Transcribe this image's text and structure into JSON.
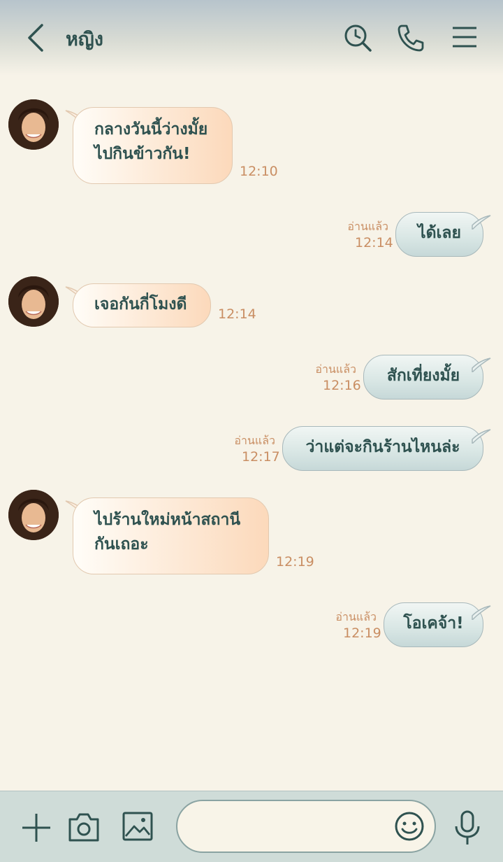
{
  "header": {
    "title": "หญิง",
    "icons": [
      "back-icon",
      "search-history-icon",
      "phone-icon",
      "menu-icon"
    ]
  },
  "messages": [
    {
      "side": "left",
      "text": "กลางวันนี้ว่างมั้ย\nไปกินข้าวกัน!",
      "time": "12:10"
    },
    {
      "side": "right",
      "text": "ได้เลย",
      "time": "12:14",
      "read": "อ่านแล้ว"
    },
    {
      "side": "left",
      "text": "เจอกันกี่โมงดี",
      "time": "12:14"
    },
    {
      "side": "right",
      "text": "สักเที่ยงมั้ย",
      "time": "12:16",
      "read": "อ่านแล้ว"
    },
    {
      "side": "right",
      "text": "ว่าแต่จะกินร้านไหนล่ะ",
      "time": "12:17",
      "read": "อ่านแล้ว"
    },
    {
      "side": "left",
      "text": "ไปร้านใหม่หน้าสถานี\nกันเถอะ",
      "time": "12:19"
    },
    {
      "side": "right",
      "text": "โอเคจ้า!",
      "time": "12:19",
      "read": "อ่านแล้ว"
    }
  ],
  "input": {
    "placeholder": "",
    "value": ""
  },
  "bottom_icons": [
    "plus-icon",
    "camera-icon",
    "image-icon",
    "emoji-icon",
    "mic-icon"
  ],
  "colors": {
    "background": "#f7f3e8",
    "accent": "#2f5250",
    "time_text": "#c98e63",
    "incoming_bubble": "#fcd9bb",
    "outgoing_bubble": "#d8e6e4"
  }
}
